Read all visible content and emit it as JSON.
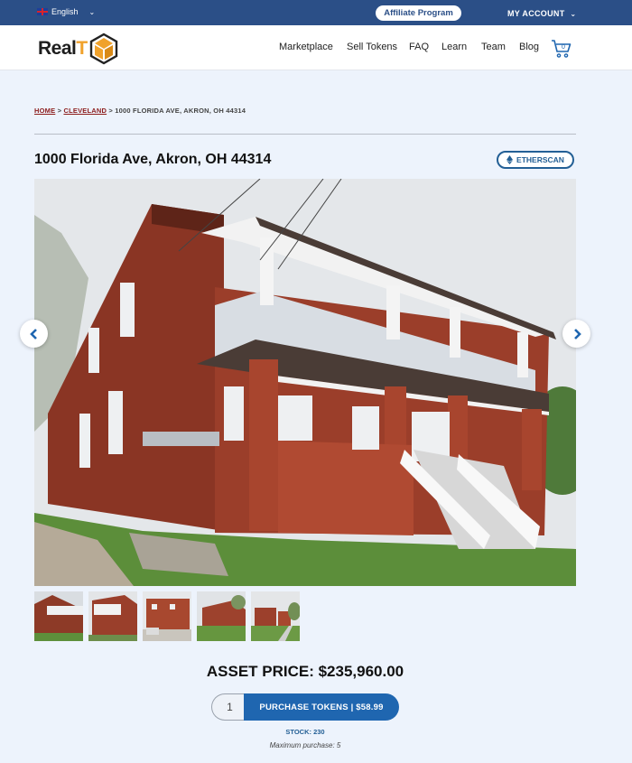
{
  "topbar": {
    "language": "English",
    "affiliate_label": "Affiliate Program",
    "account_label": "MY ACCOUNT"
  },
  "brand": {
    "name_prefix": "Real",
    "name_suffix": "T"
  },
  "nav": {
    "items": [
      {
        "label": "Marketplace"
      },
      {
        "label": "Sell Tokens"
      },
      {
        "label": "FAQ"
      },
      {
        "label": "Learn"
      },
      {
        "label": "Team"
      },
      {
        "label": "Blog"
      }
    ],
    "cart_count": "0"
  },
  "breadcrumb": {
    "home": "HOME",
    "sep1": " > ",
    "city": "CLEVELAND",
    "sep2": " > ",
    "current": "1000 FLORIDA AVE, AKRON, OH 44314"
  },
  "property": {
    "title": "1000 Florida Ave, Akron, OH 44314",
    "etherscan_label": "ETHERSCAN"
  },
  "colors": {
    "topbar": "#2b4f87",
    "accent": "#1f66b0",
    "breadcrumb_link": "#8c1b1b"
  },
  "purchase": {
    "asset_price": "ASSET PRICE: $235,960.00",
    "quantity": "1",
    "button_label": "PURCHASE TOKENS | $58.99",
    "stock": "STOCK: 230",
    "max_purchase": "Maximum purchase: 5"
  }
}
